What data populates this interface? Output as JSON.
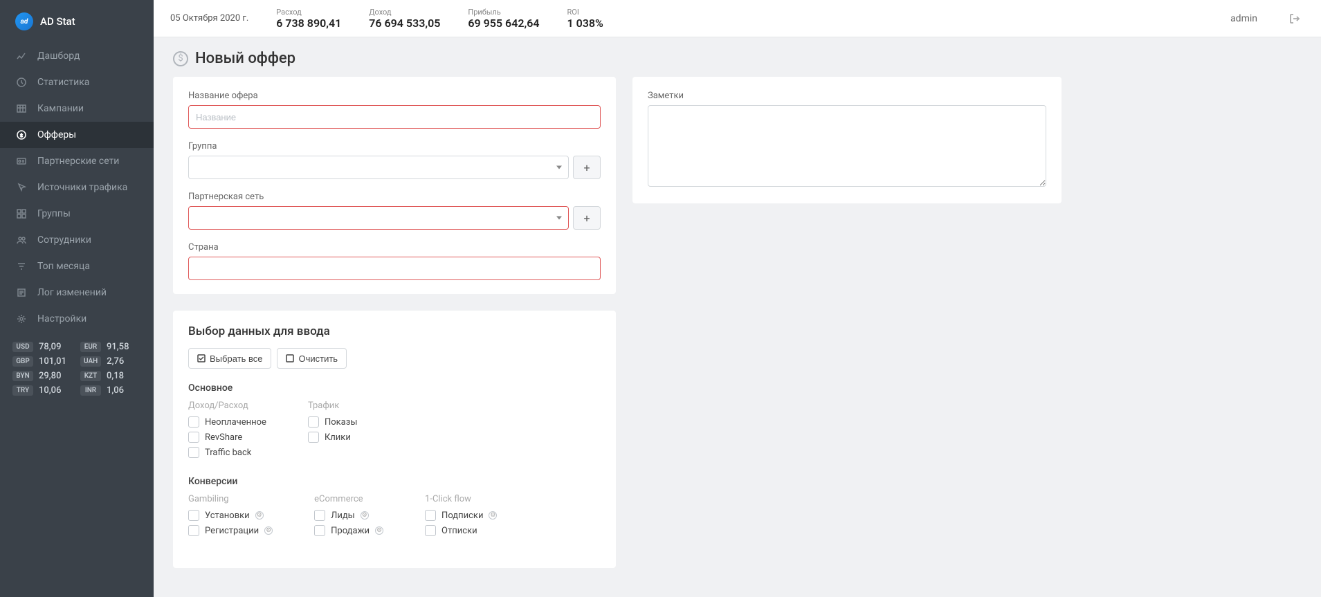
{
  "app_name": "AD Stat",
  "topbar": {
    "date": "05 Октября 2020 г.",
    "metrics": [
      {
        "label": "Расход",
        "value": "6 738 890,41"
      },
      {
        "label": "Доход",
        "value": "76 694 533,05"
      },
      {
        "label": "Прибыль",
        "value": "69 955 642,64"
      },
      {
        "label": "ROI",
        "value": "1 038%"
      }
    ],
    "user": "admin"
  },
  "sidebar": {
    "items": [
      {
        "label": "Дашборд",
        "icon": "chart-icon"
      },
      {
        "label": "Статистика",
        "icon": "clock-icon"
      },
      {
        "label": "Кампании",
        "icon": "grid-icon"
      },
      {
        "label": "Офферы",
        "icon": "dollar-icon",
        "active": true
      },
      {
        "label": "Партнерские сети",
        "icon": "id-icon"
      },
      {
        "label": "Источники трафика",
        "icon": "cursor-icon"
      },
      {
        "label": "Группы",
        "icon": "dashboard-icon"
      },
      {
        "label": "Сотрудники",
        "icon": "users-icon"
      },
      {
        "label": "Топ месяца",
        "icon": "filter-icon"
      },
      {
        "label": "Лог изменений",
        "icon": "list-icon"
      },
      {
        "label": "Настройки",
        "icon": "gear-icon"
      }
    ],
    "rates": [
      {
        "cur": "USD",
        "val": "78,09"
      },
      {
        "cur": "EUR",
        "val": "91,58"
      },
      {
        "cur": "GBP",
        "val": "101,01"
      },
      {
        "cur": "UAH",
        "val": "2,76"
      },
      {
        "cur": "BYN",
        "val": "29,80"
      },
      {
        "cur": "KZT",
        "val": "0,18"
      },
      {
        "cur": "TRY",
        "val": "10,06"
      },
      {
        "cur": "INR",
        "val": "1,06"
      }
    ]
  },
  "page": {
    "title": "Новый оффер"
  },
  "form": {
    "name_label": "Название офера",
    "name_placeholder": "Название",
    "group_label": "Группа",
    "network_label": "Партнерская сеть",
    "country_label": "Страна",
    "notes_label": "Заметки"
  },
  "data_sel": {
    "title": "Выбор данных для ввода",
    "select_all": "Выбрать все",
    "clear": "Очистить",
    "main_title": "Основное",
    "income_label": "Доход/Расход",
    "income_items": [
      "Неоплаченное",
      "RevShare",
      "Traffic back"
    ],
    "traffic_label": "Трафик",
    "traffic_items": [
      "Показы",
      "Клики"
    ],
    "conv_title": "Конверсии",
    "gambling_label": "Gambiling",
    "gambling_items": [
      "Установки",
      "Регистрации"
    ],
    "ecom_label": "eCommerce",
    "ecom_items": [
      "Лиды",
      "Продажи"
    ],
    "oneclick_label": "1-Click flow",
    "oneclick_items": [
      "Подписки",
      "Отписки"
    ]
  }
}
